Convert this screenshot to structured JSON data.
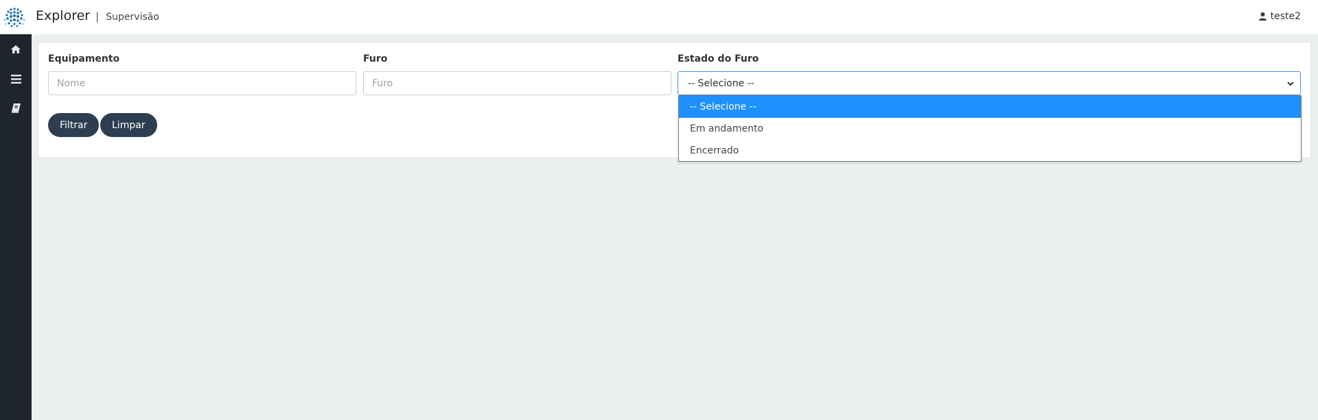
{
  "header": {
    "brand": "Explorer",
    "separator": "|",
    "subtitle": "Supervisão",
    "user_name": "teste2"
  },
  "sidebar": {
    "items": [
      {
        "icon": "home-icon"
      },
      {
        "icon": "menu-icon"
      },
      {
        "icon": "book-icon"
      }
    ]
  },
  "filters": {
    "equipamento": {
      "label": "Equipamento",
      "placeholder": "Nome",
      "value": ""
    },
    "furo": {
      "label": "Furo",
      "placeholder": "Furo",
      "value": ""
    },
    "estado": {
      "label": "Estado do Furo",
      "selected": "-- Selecione --",
      "options": [
        "-- Selecione --",
        "Em andamento",
        "Encerrado"
      ]
    }
  },
  "buttons": {
    "filter": "Filtrar",
    "clear": "Limpar"
  },
  "colors": {
    "sidebar": "#1e252c",
    "button": "#2c3e50",
    "highlight": "#1e90ff",
    "background": "#ecf0f1"
  }
}
